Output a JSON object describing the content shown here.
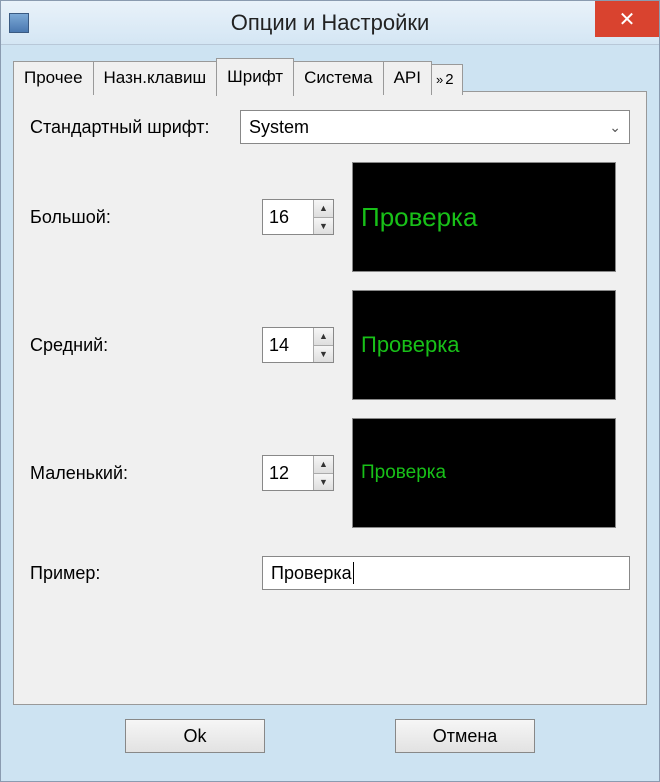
{
  "window": {
    "title": "Опции и Настройки"
  },
  "tabs": {
    "items": [
      {
        "label": "Прочее"
      },
      {
        "label": "Назн.клавиш"
      },
      {
        "label": "Шрифт"
      },
      {
        "label": "Система"
      },
      {
        "label": "API"
      }
    ],
    "overflow_indicator": "2",
    "active_index": 2
  },
  "font_panel": {
    "standard_label": "Стандартный шрифт:",
    "standard_value": "System",
    "big_label": "Большой:",
    "big_value": "16",
    "big_preview": "Проверка",
    "medium_label": "Средний:",
    "medium_value": "14",
    "medium_preview": "Проверка",
    "small_label": "Маленький:",
    "small_value": "12",
    "small_preview": "Проверка",
    "sample_label": "Пример:",
    "sample_value": "Проверка"
  },
  "buttons": {
    "ok": "Ok",
    "cancel": "Отмена"
  }
}
